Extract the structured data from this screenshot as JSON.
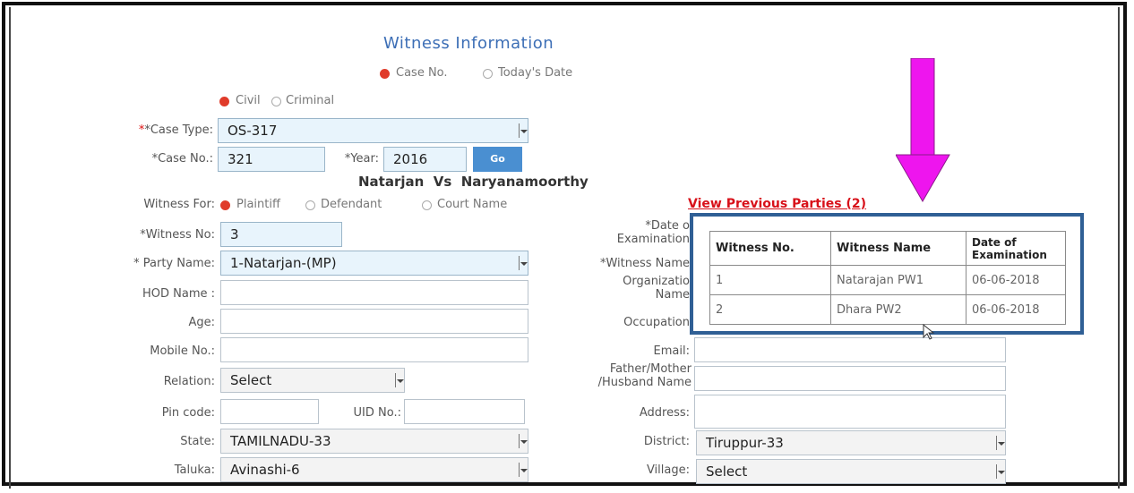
{
  "form": {
    "title": "Witness Information",
    "search_options": [
      {
        "label": "Case No.",
        "selected": true
      },
      {
        "label": "Today's Date",
        "selected": false
      }
    ],
    "case_category": [
      {
        "label": "Civil",
        "selected": true
      },
      {
        "label": "Criminal",
        "selected": false
      }
    ],
    "case_type": {
      "label": "*Case Type:",
      "value": "OS-317"
    },
    "case_no": {
      "label": "*Case No.:",
      "value": "321"
    },
    "year": {
      "label": "*Year:",
      "value": "2016"
    },
    "go_label": "Go",
    "parties_title": "Natarjan  Vs  Naryanamoorthy",
    "witness_for": {
      "label": "Witness For:",
      "options": [
        {
          "label": "Plaintiff",
          "selected": true
        },
        {
          "label": "Defendant",
          "selected": false
        },
        {
          "label": "Court Name",
          "selected": false
        }
      ]
    },
    "witness_no": {
      "label": "*Witness  No:",
      "value": "3"
    },
    "party_name": {
      "label": "* Party Name:",
      "value": "1-Natarjan-(MP)"
    },
    "hod_name": {
      "label": "HOD Name :",
      "value": ""
    },
    "age": {
      "label": "Age:",
      "value": ""
    },
    "mobile": {
      "label": "Mobile No.:",
      "value": ""
    },
    "relation": {
      "label": "Relation:",
      "value": "Select"
    },
    "pin_code": {
      "label": "Pin code:",
      "value": ""
    },
    "uid": {
      "label": "UID No.:",
      "value": ""
    },
    "state": {
      "label": "State:",
      "value": "TAMILNADU-33"
    },
    "taluka": {
      "label": "Taluka:",
      "value": "Avinashi-6"
    },
    "date_of_exam": {
      "label_line1": "*Date o",
      "label_line2": "Examination"
    },
    "witness_name": {
      "label": "*Witness Name"
    },
    "organization": {
      "label_line1": "Organizatio",
      "label_line2": "Name"
    },
    "occupation": {
      "label": "Occupation"
    },
    "email": {
      "label": "Email:"
    },
    "father_mother": {
      "label_line1": "Father/Mother",
      "label_line2": "/Husband Name"
    },
    "address": {
      "label": "Address:"
    },
    "district": {
      "label": "District:",
      "value": "Tiruppur-33"
    },
    "village": {
      "label": "Village:",
      "value": "Select"
    }
  },
  "previous_parties": {
    "link_text": "View Previous Parties (2)",
    "headers": [
      "Witness No.",
      "Witness Name",
      "Date of Examination"
    ],
    "rows": [
      {
        "no": "1",
        "name": "Natarajan PW1",
        "date": "06-06-2018"
      },
      {
        "no": "2",
        "name": "Dhara PW2",
        "date": "06-06-2018"
      }
    ]
  },
  "colors": {
    "title": "#3d6fb6",
    "link": "#d8111a",
    "popup_border": "#2f5f95",
    "arrow": "#ee15ee",
    "go_button": "#4a8fd1"
  }
}
